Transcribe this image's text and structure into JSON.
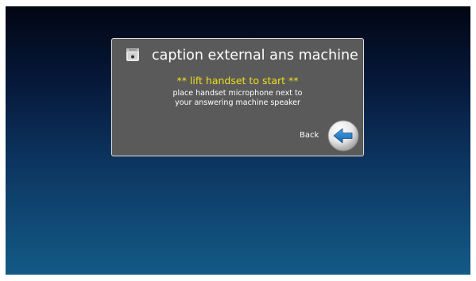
{
  "dialog": {
    "title": "caption external ans machine",
    "title_icon": "answering-machine-icon",
    "headline": "** lift handset to start **",
    "message_line1": "place handset microphone next to",
    "message_line2": "your answering machine speaker",
    "back_label": "Back",
    "back_icon": "arrow-left-icon"
  },
  "colors": {
    "headline": "#f2df1c",
    "dialog_background": "#5a5a5a",
    "arrow": "#1f7fc4"
  }
}
